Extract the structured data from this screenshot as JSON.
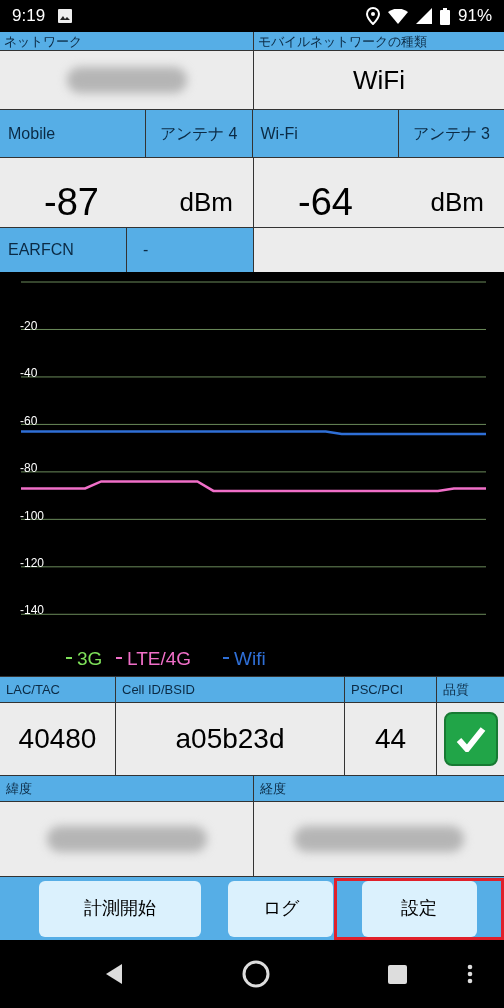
{
  "status_bar": {
    "time": "9:19",
    "battery": "91%"
  },
  "network": {
    "label": "ネットワーク"
  },
  "network_type": {
    "label": "モバイルネットワークの種類",
    "value": "WiFi"
  },
  "signals": [
    {
      "label": "Mobile",
      "antenna": "アンテナ 4",
      "value": "-87",
      "unit": "dBm"
    },
    {
      "label": "Wi-Fi",
      "antenna": "アンテナ 3",
      "value": "-64",
      "unit": "dBm"
    }
  ],
  "earfcn": {
    "label": "EARFCN",
    "value": "-"
  },
  "chart_data": {
    "type": "line",
    "categories": [
      null,
      null,
      null,
      null,
      null,
      null,
      null,
      null,
      null,
      null,
      null,
      null,
      null,
      null,
      null,
      null,
      null,
      null,
      null,
      null,
      null,
      null,
      null,
      null,
      null,
      null,
      null,
      null,
      null,
      null
    ],
    "ylim": [
      -166,
      0
    ],
    "grid": true,
    "legend": "bottom",
    "yticks": [
      -20,
      -40,
      -60,
      -80,
      -100,
      -120,
      -140
    ],
    "series": [
      {
        "name": "3G",
        "color": "#7ee05a",
        "values": [
          null,
          null,
          null,
          null,
          null,
          null,
          null,
          null,
          null,
          null,
          null,
          null,
          null,
          null,
          null,
          null,
          null,
          null,
          null,
          null,
          null,
          null,
          null,
          null,
          null,
          null,
          null,
          null,
          null,
          null
        ]
      },
      {
        "name": "LTE/4G",
        "color": "#f06fc8",
        "values": [
          -87,
          -87,
          -87,
          -87,
          -87,
          -84,
          -84,
          -84,
          -84,
          -84,
          -84,
          -84,
          -88,
          -88,
          -88,
          -88,
          -88,
          -88,
          -88,
          -88,
          -88,
          -88,
          -88,
          -88,
          -88,
          -88,
          -88,
          -87,
          -87,
          -87
        ]
      },
      {
        "name": "Wifi",
        "color": "#2f6fd6",
        "values": [
          -63,
          -63,
          -63,
          -63,
          -63,
          -63,
          -63,
          -63,
          -63,
          -63,
          -63,
          -63,
          -63,
          -63,
          -63,
          -63,
          -63,
          -63,
          -63,
          -63,
          -64,
          -64,
          -64,
          -64,
          -64,
          -64,
          -64,
          -64,
          -64,
          -64
        ]
      }
    ]
  },
  "cell_table": {
    "columns": [
      "LAC/TAC",
      "Cell ID/BSID",
      "PSC/PCI"
    ],
    "values": [
      "40480",
      "a05b23d",
      "44"
    ]
  },
  "quality": {
    "label": "品質",
    "ok": true
  },
  "location": {
    "latitude_label": "緯度",
    "longitude_label": "経度"
  },
  "buttons": [
    {
      "label": "計測開始",
      "highlighted": false
    },
    {
      "label": "ログ",
      "highlighted": false
    },
    {
      "label": "設定",
      "highlighted": true
    }
  ]
}
